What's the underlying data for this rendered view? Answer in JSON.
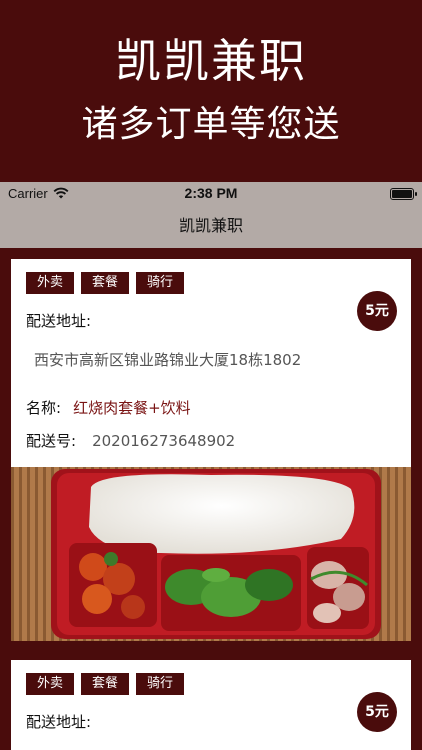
{
  "promo": {
    "line1": "凯凯兼职",
    "line2": "诸多订单等您送"
  },
  "status": {
    "carrier": "Carrier",
    "time": "2:38 PM"
  },
  "nav": {
    "title": "凯凯兼职"
  },
  "orders": [
    {
      "tags": [
        "外卖",
        "套餐",
        "骑行"
      ],
      "price": "5元",
      "address_label": "配送地址:",
      "address": "西安市高新区锦业路锦业大厦18栋1802",
      "name_label": "名称:",
      "name": "红烧肉套餐+饮料",
      "number_label": "配送号:",
      "number": "202016273648902"
    },
    {
      "tags": [
        "外卖",
        "套餐",
        "骑行"
      ],
      "price": "5元",
      "address_label": "配送地址:"
    }
  ]
}
